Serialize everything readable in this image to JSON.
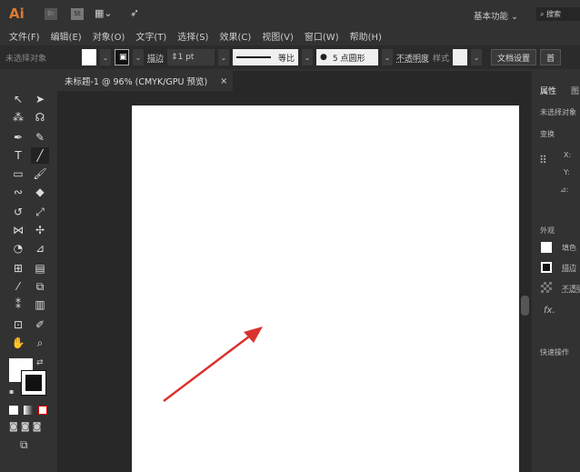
{
  "app": {
    "logo": "Ai",
    "br": "Br",
    "st": "St",
    "workspace": "基本功能",
    "search_placeholder": "搜索"
  },
  "menu": [
    "文件(F)",
    "编辑(E)",
    "对象(O)",
    "文字(T)",
    "选择(S)",
    "效果(C)",
    "视图(V)",
    "窗口(W)",
    "帮助(H)"
  ],
  "control": {
    "selection": "未选择对象",
    "stroke_label": "描边",
    "stroke_value": "1 pt",
    "profile": "等比",
    "brush": "5 点圆形",
    "opacity": "不透明度",
    "style": "样式",
    "doc_setup": "文档设置",
    "prefs": "首"
  },
  "document": {
    "tab": "未标题-1 @ 96% (CMYK/GPU 预览)",
    "close": "×"
  },
  "panel": {
    "tab1": "属性",
    "tab2": "图",
    "no_selection": "未选择对象",
    "transform": "变换",
    "x": "X:",
    "y": "Y:",
    "angle": "⊿:",
    "appearance": "外观",
    "fill": "填色",
    "stroke": "描边",
    "opacity": "不透明",
    "fx": "fx.",
    "quick": "快速操作"
  },
  "colors": {
    "arrow": "#d9332f"
  }
}
